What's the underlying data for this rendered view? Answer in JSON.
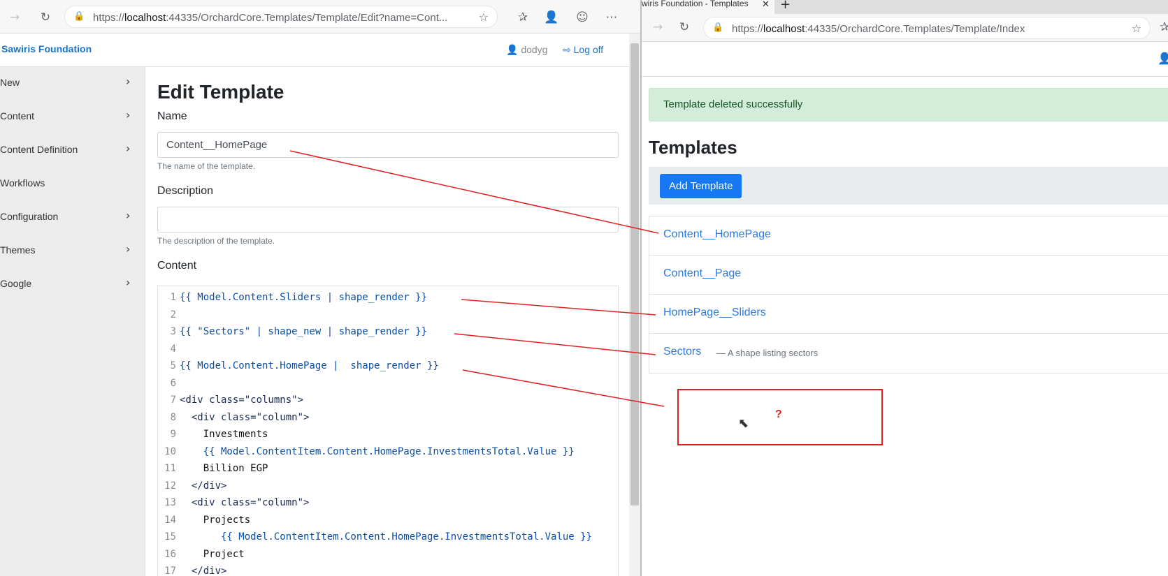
{
  "left_browser": {
    "url_prefix": "https://",
    "url_host": "localhost",
    "url_rest": ":44335/OrchardCore.Templates/Template/Edit?name=Cont..."
  },
  "site": {
    "brand": "Sawiris Foundation",
    "user": "dodyg",
    "logoff": "Log off"
  },
  "sidebar": {
    "items": [
      {
        "label": "New",
        "has_children": true
      },
      {
        "label": "Content",
        "has_children": true
      },
      {
        "label": "Content Definition",
        "has_children": true
      },
      {
        "label": "Workflows",
        "has_children": false
      },
      {
        "label": "Configuration",
        "has_children": true
      },
      {
        "label": "Themes",
        "has_children": true
      },
      {
        "label": "Google",
        "has_children": true
      }
    ]
  },
  "edit_form": {
    "title": "Edit Template",
    "name_label": "Name",
    "name_value": "Content__HomePage",
    "name_hint": "The name of the template.",
    "description_label": "Description",
    "description_value": "",
    "description_hint": "The description of the template.",
    "content_label": "Content",
    "code_lines": [
      {
        "n": "1",
        "text": "{{ Model.Content.Sliders | shape_render }}",
        "kind": "liquid"
      },
      {
        "n": "2",
        "text": "",
        "kind": "plain"
      },
      {
        "n": "3",
        "text": "{{ \"Sectors\" | shape_new | shape_render }}",
        "kind": "liquid"
      },
      {
        "n": "4",
        "text": "",
        "kind": "plain"
      },
      {
        "n": "5",
        "text": "{{ Model.Content.HomePage |  shape_render }}",
        "kind": "liquid"
      },
      {
        "n": "6",
        "text": "",
        "kind": "plain"
      },
      {
        "n": "7",
        "text": "<div class=\"columns\">",
        "kind": "tag"
      },
      {
        "n": "8",
        "text": "  <div class=\"column\">",
        "kind": "tag"
      },
      {
        "n": "9",
        "text": "    Investments",
        "kind": "plain"
      },
      {
        "n": "10",
        "text": "    {{ Model.ContentItem.Content.HomePage.InvestmentsTotal.Value }}",
        "kind": "liquid"
      },
      {
        "n": "11",
        "text": "    Billion EGP",
        "kind": "plain"
      },
      {
        "n": "12",
        "text": "  </div>",
        "kind": "tag"
      },
      {
        "n": "13",
        "text": "  <div class=\"column\">",
        "kind": "tag"
      },
      {
        "n": "14",
        "text": "    Projects",
        "kind": "plain"
      },
      {
        "n": "15",
        "text": "       {{ Model.ContentItem.Content.HomePage.InvestmentsTotal.Value }}",
        "kind": "liquid"
      },
      {
        "n": "16",
        "text": "    Project",
        "kind": "plain"
      },
      {
        "n": "17",
        "text": "  </div>",
        "kind": "tag"
      }
    ]
  },
  "right_browser": {
    "tab_title": "wiris Foundation - Templates",
    "url_prefix": "https://",
    "url_host": "localhost",
    "url_rest": ":44335/OrchardCore.Templates/Template/Index"
  },
  "templates_page": {
    "alert": "Template deleted successfully",
    "title": "Templates",
    "add_button": "Add Template",
    "items": [
      {
        "name": "Content__HomePage",
        "desc": ""
      },
      {
        "name": "Content__Page",
        "desc": ""
      },
      {
        "name": "HomePage__Sliders",
        "desc": ""
      },
      {
        "name": "Sectors",
        "desc": "— A shape listing sectors"
      }
    ]
  },
  "annotation": {
    "question_mark": "?",
    "color": "#e02020"
  }
}
